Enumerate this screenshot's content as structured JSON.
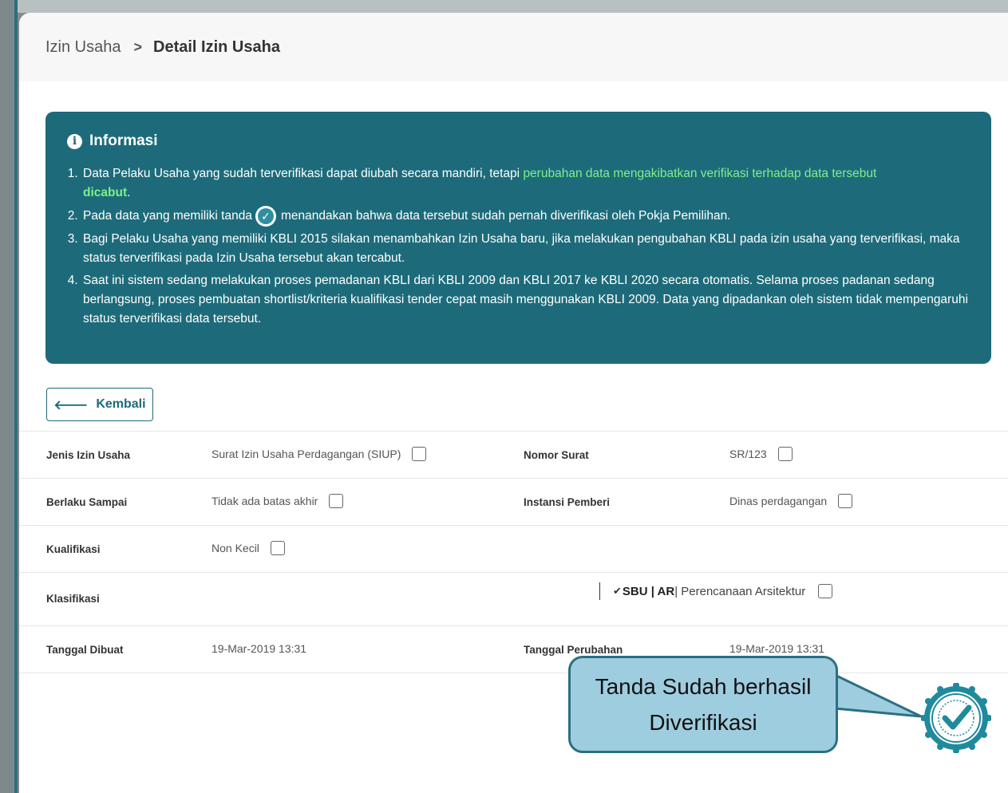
{
  "breadcrumb": {
    "parent": "Izin Usaha",
    "separator": ">",
    "current": "Detail Izin Usaha"
  },
  "info": {
    "title": "Informasi",
    "item1_pre": "Data Pelaku Usaha yang sudah terverifikasi dapat diubah secara mandiri, tetapi ",
    "item1_highlight": "perubahan data mengakibatkan verifikasi terhadap data tersebut",
    "item1_bold": "dicabut",
    "item1_post": ".",
    "item2_pre": "Pada data yang memiliki tanda",
    "item2_post": "menandakan bahwa data tersebut sudah pernah diverifikasi oleh Pokja Pemilihan.",
    "item3": "Bagi Pelaku Usaha yang memiliki KBLI 2015 silakan menambahkan Izin Usaha baru, jika melakukan pengubahan KBLI pada izin usaha yang terverifikasi, maka status terverifikasi pada Izin Usaha tersebut akan tercabut.",
    "item4": "Saat ini sistem sedang melakukan proses pemadanan KBLI dari KBLI 2009 dan KBLI 2017 ke KBLI 2020 secara otomatis. Selama proses padanan sedang berlangsung, proses pembuatan shortlist/kriteria kualifikasi tender cepat masih menggunakan KBLI 2009. Data yang dipadankan oleh sistem tidak mempengaruhi status terverifikasi data tersebut."
  },
  "back_button": {
    "label": "Kembali"
  },
  "details": {
    "jenis_label": "Jenis Izin Usaha",
    "jenis_value": "Surat Izin Usaha Perdagangan (SIUP)",
    "nomor_label": "Nomor Surat",
    "nomor_value": "SR/123",
    "berlaku_label": "Berlaku Sampai",
    "berlaku_value": "Tidak ada batas akhir",
    "instansi_label": "Instansi Pemberi",
    "instansi_value": "Dinas perdagangan",
    "kualifikasi_label": "Kualifikasi",
    "kualifikasi_value": "Non Kecil",
    "klasifikasi_label": "Klasifikasi",
    "klasifikasi_prefix": "SBU | AR",
    "klasifikasi_value": "| Perencanaan Arsitektur",
    "dibuat_label": "Tanggal Dibuat",
    "dibuat_value": "19-Mar-2019 13:31",
    "perubahan_label": "Tanggal Perubahan",
    "perubahan_value": "19-Mar-2019 13:31"
  },
  "callout": {
    "line1": "Tanda Sudah berhasil",
    "line2": "Diverifikasi"
  },
  "colors": {
    "teal": "#1d6b7a",
    "highlight": "#7df08a",
    "callout_bg": "#9fcde0"
  },
  "icons": {
    "info": "info-circle-icon",
    "back": "arrow-left-icon",
    "verified": "verified-check-icon",
    "seal": "verified-seal-icon"
  }
}
